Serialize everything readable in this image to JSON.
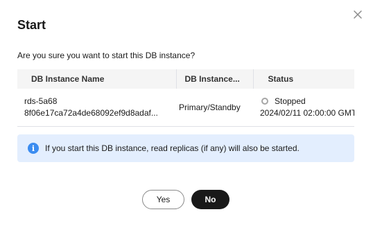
{
  "dialog": {
    "title": "Start",
    "question": "Are you sure you want to start this DB instance?",
    "close_icon": "close-icon"
  },
  "table": {
    "headers": [
      "DB Instance Name",
      "DB Instance...",
      "Status"
    ],
    "rows": [
      {
        "name": "rds-5a68",
        "id": "8f06e17ca72a4de68092ef9d8adaf...",
        "type": "Primary/Standby",
        "status": "Stopped",
        "status_icon": "stopped-status-icon",
        "time": "2024/02/11 02:00:00 GMT"
      }
    ]
  },
  "notice": {
    "icon": "info-icon",
    "icon_glyph": "i",
    "text": "If you start this DB instance, read replicas (if any) will also be started."
  },
  "buttons": {
    "yes_label": "Yes",
    "no_label": "No"
  },
  "colors": {
    "primary_button": "#191919",
    "info_background": "#e3eefe",
    "info_icon": "#3b8cf0",
    "status_stopped": "#a6a6a6"
  }
}
